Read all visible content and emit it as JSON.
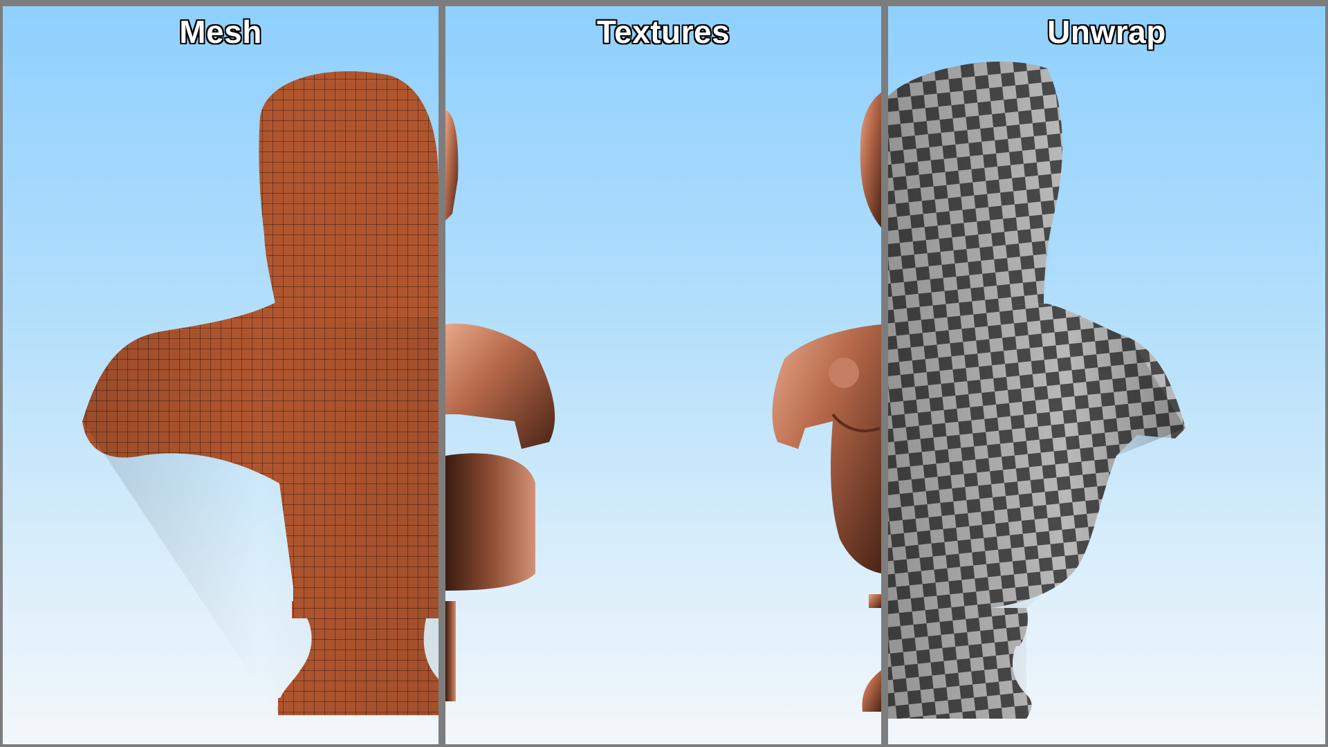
{
  "panels": [
    {
      "id": "mesh",
      "title": "Mesh"
    },
    {
      "id": "textures",
      "title": "Textures"
    },
    {
      "id": "unwrap",
      "title": "Unwrap"
    }
  ],
  "colors": {
    "sky_top": "#8fd0ff",
    "sky_bottom": "#f3f7fa",
    "frame": "#7d7d7d",
    "mesh_fill": "#b0562f",
    "mesh_wire": "#3a160a",
    "bronze_light": "#d9957a",
    "bronze_dark": "#4a2416",
    "checker_light": "#b9b9b9",
    "checker_dark": "#4a4a4a"
  }
}
